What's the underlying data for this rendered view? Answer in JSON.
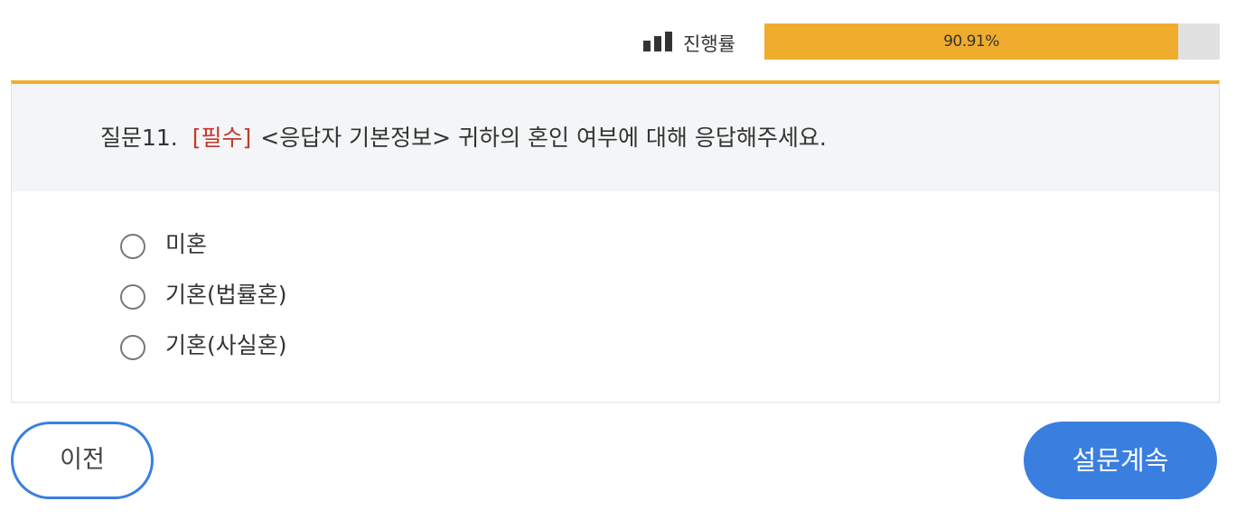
{
  "progress": {
    "icon": "bar-chart-icon",
    "label": "진행률",
    "value_percent": 90.91,
    "text": "90.91%",
    "fill_color": "#f0ad2d",
    "track_color": "#e1e1e1"
  },
  "question": {
    "number_label": "질문11.",
    "required_tag": "[필수]",
    "text": "<응답자 기본정보> 귀하의 혼인 여부에 대해 응답해주세요.",
    "accent_color": "#f0ad2d",
    "required_color": "#c0392b"
  },
  "options": [
    {
      "label": "미혼",
      "selected": false
    },
    {
      "label": "기혼(법률혼)",
      "selected": false
    },
    {
      "label": "기혼(사실혼)",
      "selected": false
    }
  ],
  "buttons": {
    "prev_label": "이전",
    "next_label": "설문계속",
    "primary_color": "#3a7fe0"
  }
}
